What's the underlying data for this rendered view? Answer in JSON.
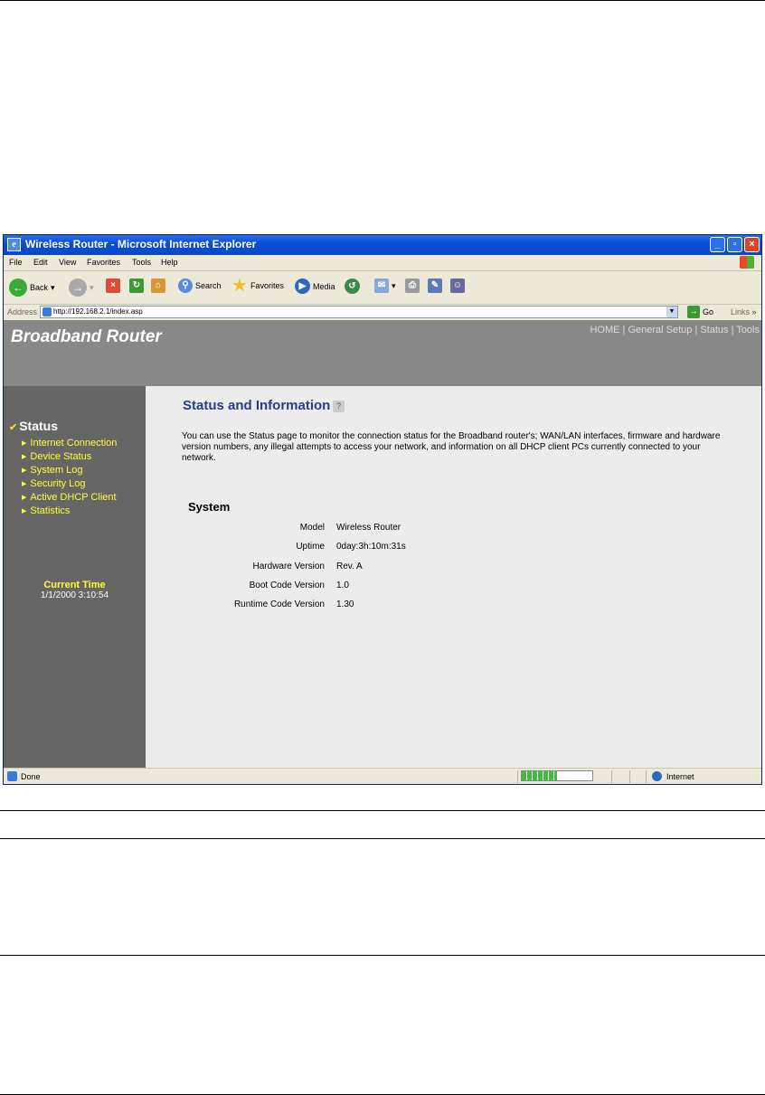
{
  "window": {
    "title": "Wireless Router - Microsoft Internet Explorer",
    "minimize": "_",
    "maximize": "▫",
    "close": "×"
  },
  "menu": [
    "File",
    "Edit",
    "View",
    "Favorites",
    "Tools",
    "Help"
  ],
  "toolbar": {
    "back": "Back",
    "search": "Search",
    "favorites": "Favorites",
    "media": "Media"
  },
  "address": {
    "label": "Address",
    "url": "http://192.168.2.1/index.asp",
    "go": "Go",
    "links": "Links"
  },
  "router": {
    "brand": "Broadband Router",
    "nav": "HOME | General Setup | Status | Tools"
  },
  "sidebar": {
    "section": "Status",
    "items": [
      {
        "label": "Internet Connection"
      },
      {
        "label": "Device Status"
      },
      {
        "label": "System Log"
      },
      {
        "label": "Security Log"
      },
      {
        "label": "Active DHCP Client"
      },
      {
        "label": "Statistics"
      }
    ],
    "current_time_label": "Current Time",
    "current_time": "1/1/2000 3:10:54"
  },
  "content": {
    "title": "Status and Information",
    "intro": "You can use the Status page to monitor the connection status for the Broadband router's; WAN/LAN interfaces, firmware and hardware version numbers, any illegal attempts to access your network, and information on all DHCP client PCs currently connected to your network.",
    "system_heading": "System",
    "system": [
      {
        "label": "Model",
        "value": "Wireless Router"
      },
      {
        "label": "Uptime",
        "value": "0day:3h:10m:31s"
      },
      {
        "label": "Hardware Version",
        "value": "Rev. A"
      },
      {
        "label": "Boot Code Version",
        "value": "1.0"
      },
      {
        "label": "Runtime Code Version",
        "value": "1.30"
      }
    ]
  },
  "statusbar": {
    "text": "Done",
    "zone": "Internet",
    "progress": 0.5
  }
}
